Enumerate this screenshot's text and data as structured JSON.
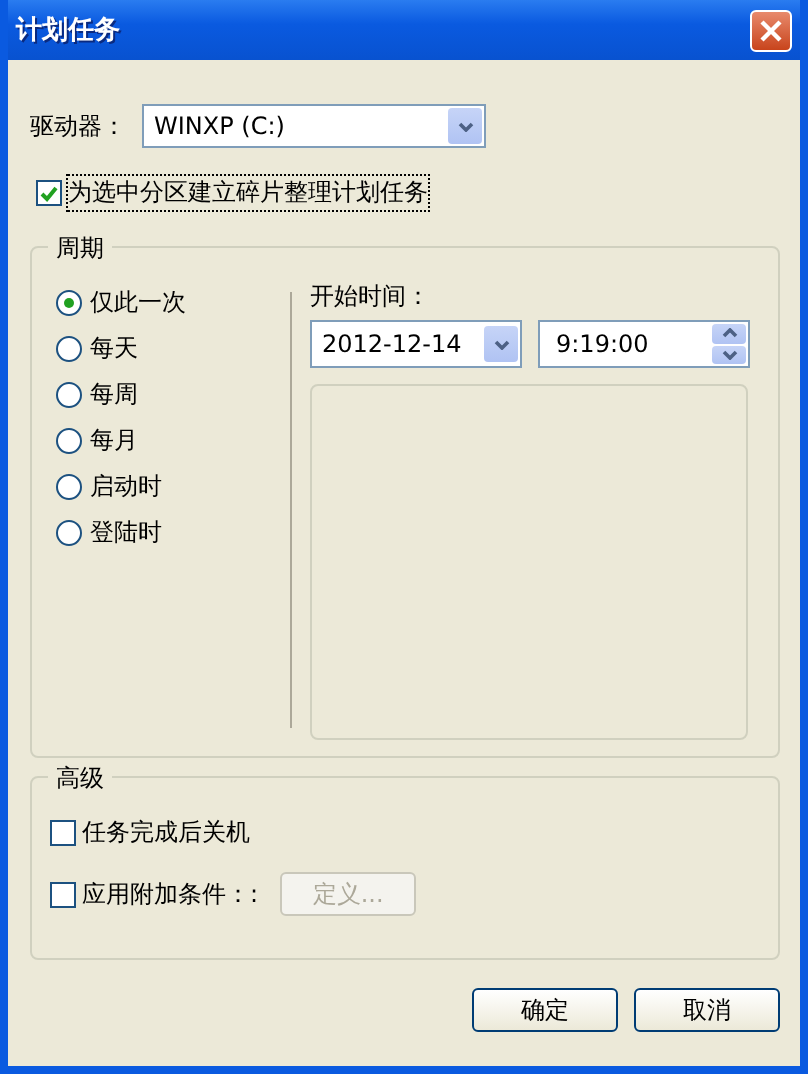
{
  "window": {
    "title": "计划任务"
  },
  "drive": {
    "label": "驱动器：",
    "value": "WINXP (C:)"
  },
  "schedule_checkbox": {
    "label": "为选中分区建立碎片整理计划任务",
    "checked": true
  },
  "period": {
    "title": "周期",
    "start_label": "开始时间：",
    "date": "2012-12-14",
    "time": "9:19:00",
    "options": [
      {
        "label": "仅此一次",
        "selected": true
      },
      {
        "label": "每天",
        "selected": false
      },
      {
        "label": "每周",
        "selected": false
      },
      {
        "label": "每月",
        "selected": false
      },
      {
        "label": "启动时",
        "selected": false
      },
      {
        "label": "登陆时",
        "selected": false
      }
    ]
  },
  "advanced": {
    "title": "高级",
    "checkboxes": [
      {
        "label": "任务完成后关机",
        "checked": false
      },
      {
        "label": "应用附加条件：:",
        "checked": false
      }
    ],
    "define_button": {
      "label": "定义...",
      "disabled": true
    }
  },
  "buttons": [
    "确定",
    "取消"
  ]
}
